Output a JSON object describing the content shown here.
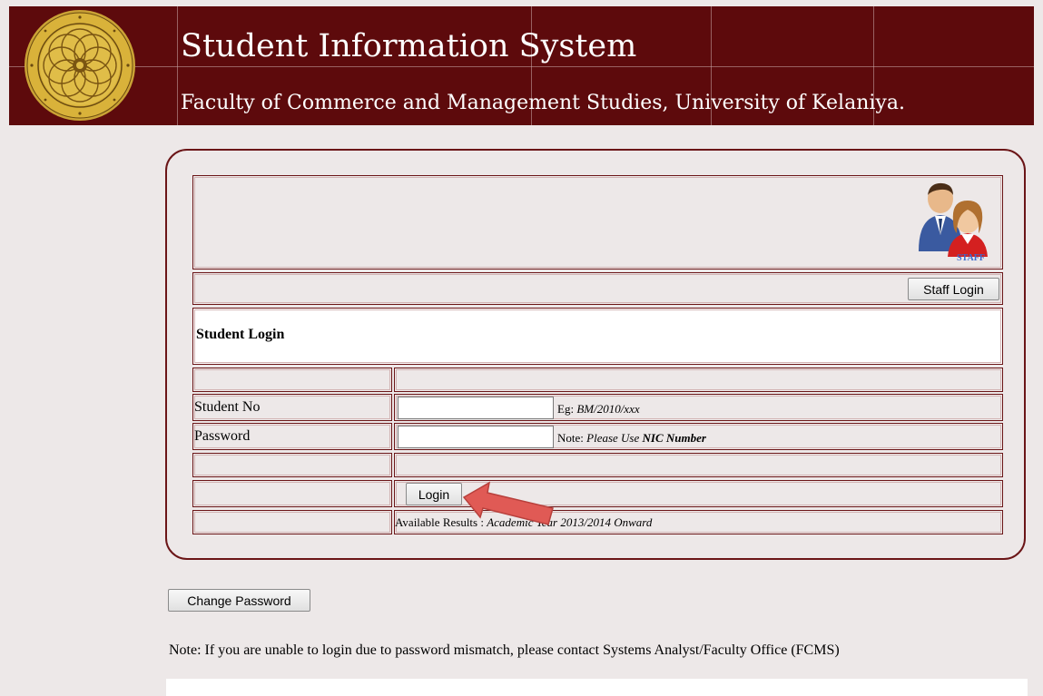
{
  "header": {
    "title": "Student Information System",
    "subtitle": "Faculty of Commerce and Management Studies, University of Kelaniya.",
    "background": "#5d0a0c",
    "logo_icon": "university-seal"
  },
  "staff": {
    "icon": "staff-users-icon",
    "icon_caption": "STAFF",
    "login_label": "Staff Login"
  },
  "student_login": {
    "heading": "Student Login",
    "student_no_label": "Student No",
    "student_no_value": "",
    "student_no_hint_prefix": "Eg: ",
    "student_no_hint_example": "BM/2010/xxx",
    "password_label": "Password",
    "password_value": "",
    "password_note_prefix": "Note: ",
    "password_note_italic": "Please Use ",
    "password_note_bold": "NIC Number",
    "login_label": "Login",
    "results_prefix": "Available Results : ",
    "results_italic": "Academic Year 2013/2014 Onward"
  },
  "change_password_label": "Change Password",
  "footer_note": "Note: If you are unable to login due to password mismatch, please contact Systems Analyst/Faculty Office (FCMS)",
  "colors": {
    "border": "#6b1517",
    "page_bg": "#ede8e8",
    "arrow": "#e05a55"
  }
}
